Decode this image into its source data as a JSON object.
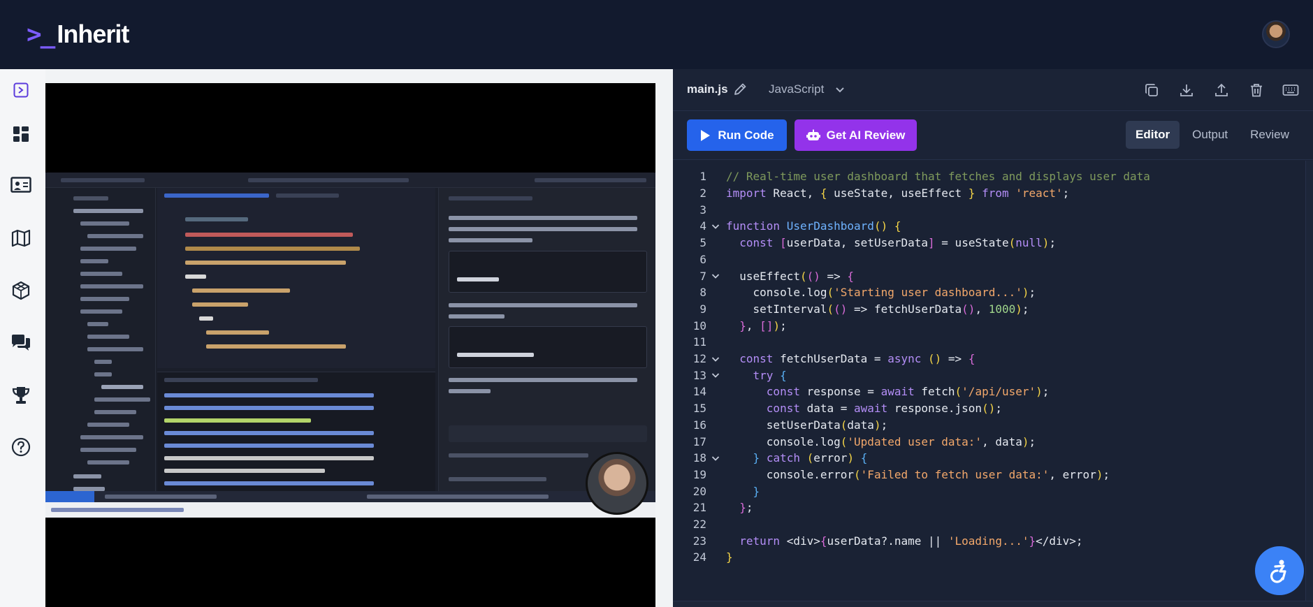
{
  "app": {
    "logo_prompt": ">_",
    "logo_name": "Inherit"
  },
  "sidebar": {
    "items": [
      {
        "name": "sidebar-toggle",
        "icon": "sidebar-toggle-icon"
      },
      {
        "name": "dashboard",
        "icon": "dashboard-icon"
      },
      {
        "name": "classroom",
        "icon": "presentation-board-icon"
      },
      {
        "name": "roadmap",
        "icon": "map-icon"
      },
      {
        "name": "projects",
        "icon": "cube-icon"
      },
      {
        "name": "community",
        "icon": "chat-bubbles-icon"
      },
      {
        "name": "leaderboard",
        "icon": "trophy-icon"
      },
      {
        "name": "help",
        "icon": "help-circle-icon"
      }
    ]
  },
  "video": {
    "description_icon": "video-player"
  },
  "editor": {
    "filename": "main.js",
    "language": "JavaScript",
    "toolbar_icons": [
      "copy-icon",
      "download-icon",
      "upload-icon",
      "trash-icon",
      "keyboard-icon"
    ],
    "run_label": "Run Code",
    "ai_label": "Get AI Review",
    "tabs": [
      {
        "label": "Editor",
        "active": true
      },
      {
        "label": "Output",
        "active": false
      },
      {
        "label": "Review",
        "active": false
      }
    ],
    "lines": [
      {
        "n": "1",
        "fold": false,
        "tokens": [
          [
            "// Real-time user dashboard that fetches and displays user data",
            "comment"
          ]
        ]
      },
      {
        "n": "2",
        "fold": false,
        "tokens": [
          [
            "import",
            "kw"
          ],
          [
            " React, ",
            "plain"
          ],
          [
            "{",
            "brace"
          ],
          [
            " useState, useEffect ",
            "plain"
          ],
          [
            "}",
            "brace"
          ],
          [
            " from ",
            "kw"
          ],
          [
            "'react'",
            "str"
          ],
          [
            ";",
            "plain"
          ]
        ]
      },
      {
        "n": "3",
        "fold": false,
        "tokens": []
      },
      {
        "n": "4",
        "fold": true,
        "tokens": [
          [
            "function",
            "kw"
          ],
          [
            " ",
            "plain"
          ],
          [
            "UserDashboard",
            "fn"
          ],
          [
            "()",
            "paren"
          ],
          [
            " ",
            "plain"
          ],
          [
            "{",
            "brace"
          ]
        ]
      },
      {
        "n": "5",
        "fold": false,
        "tokens": [
          [
            "  ",
            "plain"
          ],
          [
            "const",
            "kw"
          ],
          [
            " ",
            "plain"
          ],
          [
            "[",
            "bracket"
          ],
          [
            "userData, setUserData",
            "plain"
          ],
          [
            "]",
            "bracket"
          ],
          [
            " = useState",
            "plain"
          ],
          [
            "(",
            "paren"
          ],
          [
            "null",
            "kw"
          ],
          [
            ")",
            "paren"
          ],
          [
            ";",
            "plain"
          ]
        ]
      },
      {
        "n": "6",
        "fold": false,
        "tokens": []
      },
      {
        "n": "7",
        "fold": true,
        "tokens": [
          [
            "  useEffect",
            "plain"
          ],
          [
            "(",
            "paren"
          ],
          [
            "()",
            "paren2"
          ],
          [
            " => ",
            "plain"
          ],
          [
            "{",
            "brace2"
          ]
        ]
      },
      {
        "n": "8",
        "fold": false,
        "tokens": [
          [
            "    console.log",
            "plain"
          ],
          [
            "(",
            "paren"
          ],
          [
            "'Starting user dashboard...'",
            "str"
          ],
          [
            ")",
            "paren"
          ],
          [
            ";",
            "plain"
          ]
        ]
      },
      {
        "n": "9",
        "fold": false,
        "tokens": [
          [
            "    setInterval",
            "plain"
          ],
          [
            "(",
            "paren"
          ],
          [
            "()",
            "paren2"
          ],
          [
            " => fetchUserData",
            "plain"
          ],
          [
            "()",
            "paren2"
          ],
          [
            ", ",
            "plain"
          ],
          [
            "1000",
            "num"
          ],
          [
            ")",
            "paren"
          ],
          [
            ";",
            "plain"
          ]
        ]
      },
      {
        "n": "10",
        "fold": false,
        "tokens": [
          [
            "  ",
            "plain"
          ],
          [
            "}",
            "brace2"
          ],
          [
            ", ",
            "plain"
          ],
          [
            "[]",
            "bracket"
          ],
          [
            ")",
            "paren"
          ],
          [
            ";",
            "plain"
          ]
        ]
      },
      {
        "n": "11",
        "fold": false,
        "tokens": []
      },
      {
        "n": "12",
        "fold": true,
        "tokens": [
          [
            "  ",
            "plain"
          ],
          [
            "const",
            "kw"
          ],
          [
            " fetchUserData = ",
            "plain"
          ],
          [
            "async",
            "kw"
          ],
          [
            " ",
            "plain"
          ],
          [
            "()",
            "paren"
          ],
          [
            " => ",
            "plain"
          ],
          [
            "{",
            "brace2"
          ]
        ]
      },
      {
        "n": "13",
        "fold": true,
        "tokens": [
          [
            "    ",
            "plain"
          ],
          [
            "try",
            "kw"
          ],
          [
            " ",
            "plain"
          ],
          [
            "{",
            "brace3"
          ]
        ]
      },
      {
        "n": "14",
        "fold": false,
        "tokens": [
          [
            "      ",
            "plain"
          ],
          [
            "const",
            "kw"
          ],
          [
            " response = ",
            "plain"
          ],
          [
            "await",
            "kw"
          ],
          [
            " fetch",
            "plain"
          ],
          [
            "(",
            "paren"
          ],
          [
            "'/api/user'",
            "str"
          ],
          [
            ")",
            "paren"
          ],
          [
            ";",
            "plain"
          ]
        ]
      },
      {
        "n": "15",
        "fold": false,
        "tokens": [
          [
            "      ",
            "plain"
          ],
          [
            "const",
            "kw"
          ],
          [
            " data = ",
            "plain"
          ],
          [
            "await",
            "kw"
          ],
          [
            " response.json",
            "plain"
          ],
          [
            "()",
            "paren"
          ],
          [
            ";",
            "plain"
          ]
        ]
      },
      {
        "n": "16",
        "fold": false,
        "tokens": [
          [
            "      setUserData",
            "plain"
          ],
          [
            "(",
            "paren"
          ],
          [
            "data",
            "plain"
          ],
          [
            ")",
            "paren"
          ],
          [
            ";",
            "plain"
          ]
        ]
      },
      {
        "n": "17",
        "fold": false,
        "tokens": [
          [
            "      console.log",
            "plain"
          ],
          [
            "(",
            "paren"
          ],
          [
            "'Updated user data:'",
            "str"
          ],
          [
            ", data",
            "plain"
          ],
          [
            ")",
            "paren"
          ],
          [
            ";",
            "plain"
          ]
        ]
      },
      {
        "n": "18",
        "fold": true,
        "tokens": [
          [
            "    ",
            "plain"
          ],
          [
            "}",
            "brace3"
          ],
          [
            " ",
            "plain"
          ],
          [
            "catch",
            "kw"
          ],
          [
            " ",
            "plain"
          ],
          [
            "(",
            "paren"
          ],
          [
            "error",
            "plain"
          ],
          [
            ")",
            "paren"
          ],
          [
            " ",
            "plain"
          ],
          [
            "{",
            "brace3"
          ]
        ]
      },
      {
        "n": "19",
        "fold": false,
        "tokens": [
          [
            "      console.error",
            "plain"
          ],
          [
            "(",
            "paren"
          ],
          [
            "'Failed to fetch user data:'",
            "str"
          ],
          [
            ", error",
            "plain"
          ],
          [
            ")",
            "paren"
          ],
          [
            ";",
            "plain"
          ]
        ]
      },
      {
        "n": "20",
        "fold": false,
        "tokens": [
          [
            "    ",
            "plain"
          ],
          [
            "}",
            "brace3"
          ]
        ]
      },
      {
        "n": "21",
        "fold": false,
        "tokens": [
          [
            "  ",
            "plain"
          ],
          [
            "}",
            "brace2"
          ],
          [
            ";",
            "plain"
          ]
        ]
      },
      {
        "n": "22",
        "fold": false,
        "tokens": []
      },
      {
        "n": "23",
        "fold": false,
        "tokens": [
          [
            "  ",
            "plain"
          ],
          [
            "return",
            "kw"
          ],
          [
            " <div>",
            "plain"
          ],
          [
            "{",
            "brace2"
          ],
          [
            "userData?.name || ",
            "plain"
          ],
          [
            "'Loading...'",
            "str"
          ],
          [
            "}",
            "brace2"
          ],
          [
            "</div>;",
            "plain"
          ]
        ]
      },
      {
        "n": "24",
        "fold": false,
        "tokens": [
          [
            "}",
            "brace"
          ]
        ]
      }
    ]
  },
  "colors": {
    "comment": "#7f9a5c",
    "kw": "#b48ef7",
    "str": "#f3a86b",
    "fn": "#6fb3ff",
    "num": "#9fd58b",
    "plain": "#e5e9f0",
    "brace": "#f5d547",
    "brace2": "#d86bd8",
    "brace3": "#5ab0f5",
    "paren": "#f5d547",
    "paren2": "#d86bd8",
    "bracket": "#d86bd8",
    "accent_run": "#2563eb",
    "accent_ai": "#9333ea",
    "topbar": "#121a2e"
  },
  "accessibility": {
    "icon": "accessibility-icon"
  }
}
